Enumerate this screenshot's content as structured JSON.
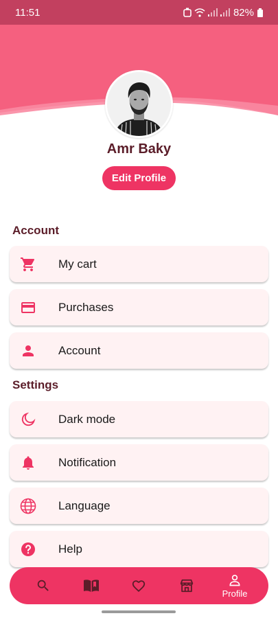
{
  "status": {
    "time": "11:51",
    "battery": "82%"
  },
  "profile": {
    "name": "Amr Baky",
    "edit_label": "Edit Profile"
  },
  "sections": {
    "account_title": "Account",
    "settings_title": "Settings"
  },
  "menu": {
    "my_cart": {
      "label": "My cart",
      "icon": "cart-icon"
    },
    "purchases": {
      "label": "Purchases",
      "icon": "credit-card-icon"
    },
    "account": {
      "label": "Account",
      "icon": "person-icon"
    },
    "dark_mode": {
      "label": "Dark mode",
      "icon": "moon-icon"
    },
    "notification": {
      "label": "Notification",
      "icon": "bell-icon"
    },
    "language": {
      "label": "Language",
      "icon": "globe-icon"
    },
    "help": {
      "label": "Help",
      "icon": "help-icon"
    }
  },
  "bottom_nav": {
    "items": [
      {
        "icon": "search-icon"
      },
      {
        "icon": "book-icon"
      },
      {
        "icon": "heart-icon"
      },
      {
        "icon": "store-icon"
      },
      {
        "icon": "profile-icon",
        "label": "Profile",
        "active": true
      }
    ]
  },
  "colors": {
    "accent": "#ee3463",
    "header": "#f5607f",
    "text_dark": "#5b1d29",
    "card": "#fff2f3",
    "status_bar": "#c2405f"
  }
}
